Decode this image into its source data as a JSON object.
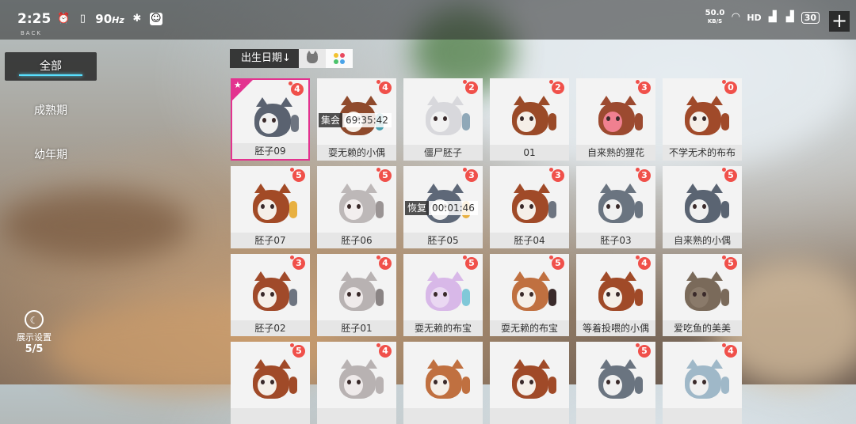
{
  "status_bar": {
    "time": "2:25",
    "refresh_rate": "90",
    "refresh_unit": "Hz",
    "net_speed": "50.0",
    "net_unit": "KB/S",
    "hd_label": "HD",
    "battery": "30"
  },
  "back_label": "BACK",
  "left_menu": {
    "items": [
      {
        "label": "全部"
      },
      {
        "label": "成熟期"
      },
      {
        "label": "幼年期"
      }
    ]
  },
  "display_settings": {
    "label": "展示设置",
    "count": "5/5"
  },
  "sort": {
    "label": "出生日期↓"
  },
  "filter_colors": [
    "#f2c230",
    "#e84a5f",
    "#4cc36b",
    "#4aa3e8"
  ],
  "cards": [
    {
      "name": "胚子09",
      "count": "4",
      "color": "#5a6270",
      "accent": "#f0f0f0",
      "tail": "#6d7480",
      "selected": true
    },
    {
      "name": "耍无赖的小偶",
      "count": "4",
      "color": "#8f4a2c",
      "accent": "#f5efe8",
      "tail": "#4aa0b0",
      "timer_label": "集会",
      "timer_value": "69:35:42"
    },
    {
      "name": "僵尸胚子",
      "count": "2",
      "color": "#d8d8dc",
      "accent": "#f2f2f2",
      "tail": "#8fa8b8"
    },
    {
      "name": "01",
      "count": "2",
      "color": "#9a4a28",
      "accent": "#f5efe8",
      "tail": "#9a4a28"
    },
    {
      "name": "自来熟的狸花",
      "count": "3",
      "color": "#9c4a30",
      "accent": "#f08090",
      "tail": "#9c4a30"
    },
    {
      "name": "不学无术的布布",
      "count": "0",
      "color": "#a04a2a",
      "accent": "#f5efe8",
      "tail": "#a04a2a"
    },
    {
      "name": "胚子07",
      "count": "5",
      "color": "#a24a26",
      "accent": "#f5efe8",
      "tail": "#e8b040"
    },
    {
      "name": "胚子06",
      "count": "5",
      "color": "#bdb8b8",
      "accent": "#f2eeee",
      "tail": "#9a9494"
    },
    {
      "name": "胚子05",
      "count": "3",
      "color": "#5e6878",
      "accent": "#f0f0f0",
      "tail": "#e8b040",
      "timer_label": "恢复",
      "timer_value": "00:01:46"
    },
    {
      "name": "胚子04",
      "count": "3",
      "color": "#a04a28",
      "accent": "#f5efe8",
      "tail": "#6d7480"
    },
    {
      "name": "胚子03",
      "count": "3",
      "color": "#6a7480",
      "accent": "#f0f0f0",
      "tail": "#6a7480"
    },
    {
      "name": "自来熟的小偶",
      "count": "5",
      "color": "#5a6472",
      "accent": "#f0f0f0",
      "tail": "#5a6472"
    },
    {
      "name": "胚子02",
      "count": "3",
      "color": "#a04a2a",
      "accent": "#f5efe8",
      "tail": "#6d7480"
    },
    {
      "name": "胚子01",
      "count": "4",
      "color": "#b8b2b2",
      "accent": "#efeaea",
      "tail": "#8a8484"
    },
    {
      "name": "耍无赖的布宝",
      "count": "5",
      "color": "#d8b8e8",
      "accent": "#ead8f2",
      "tail": "#80c8d8"
    },
    {
      "name": "耍无赖的布宝",
      "count": "5",
      "color": "#c07040",
      "accent": "#f5efe8",
      "tail": "#3a2a2a"
    },
    {
      "name": "等着投喂的小偶",
      "count": "4",
      "color": "#a04a28",
      "accent": "#f5efe8",
      "tail": "#a04a28"
    },
    {
      "name": "爱吃鱼的美美",
      "count": "5",
      "color": "#7a6a5a",
      "accent": "#8a7a6a",
      "tail": "#7a6a5a"
    },
    {
      "name": "",
      "count": "5",
      "color": "#a04a28",
      "accent": "#f5efe8",
      "tail": "#a04a28"
    },
    {
      "name": "",
      "count": "4",
      "color": "#b8b2b2",
      "accent": "#efeaea",
      "tail": "#b8b2b2"
    },
    {
      "name": "",
      "count": "",
      "color": "#c07040",
      "accent": "#f5efe8",
      "tail": "#c07040"
    },
    {
      "name": "",
      "count": "",
      "color": "#a04a28",
      "accent": "#f5efe8",
      "tail": "#a04a28"
    },
    {
      "name": "",
      "count": "5",
      "color": "#6a7480",
      "accent": "#f0f0f0",
      "tail": "#6a7480"
    },
    {
      "name": "",
      "count": "4",
      "color": "#9fb8c8",
      "accent": "#f0f0f0",
      "tail": "#9fb8c8"
    }
  ]
}
